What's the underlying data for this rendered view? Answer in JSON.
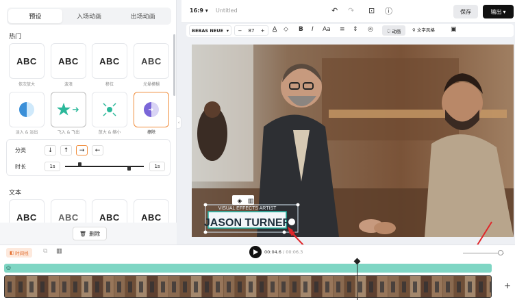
{
  "tabs": [
    "预设",
    "入场动画",
    "出场动画"
  ],
  "sections": {
    "hot": "热门",
    "text": "文本"
  },
  "cards_row1": [
    {
      "preview": "ABC",
      "label": "依次放大"
    },
    {
      "preview": "ABC",
      "label": "波浪"
    },
    {
      "preview": "ABC",
      "label": "移位"
    },
    {
      "preview": "ABC",
      "label": "光晕模糊"
    }
  ],
  "cards_row2": [
    {
      "label": "淡入 & 淡出"
    },
    {
      "label": "飞入 & 飞出"
    },
    {
      "label": "放大 & 缩小"
    },
    {
      "label": "擦除"
    }
  ],
  "cards_row3": [
    "ABC",
    "ABC",
    "ABC",
    "ABC"
  ],
  "props": {
    "category_label": "分类",
    "duration_label": "时长",
    "directions": [
      "↓",
      "↑",
      "→",
      "←"
    ],
    "time_start": "1s",
    "time_end": "1s"
  },
  "delete_label": "删除",
  "topbar": {
    "ratio": "16:9",
    "title": "Untitled",
    "save": "保存",
    "export": "输出"
  },
  "texttoolbar": {
    "font": "BEBAS NEUE",
    "size": "87",
    "animation": "动画",
    "text_style": "文字风格"
  },
  "overlay": {
    "subtitle": "VISUAL EFFECTS ARTIST",
    "name": "JASON TURNER"
  },
  "timeline": {
    "track_button": "时间线",
    "current": "00:04.6",
    "total": "00:06.3"
  },
  "colors": {
    "accent": "#f08c3a",
    "track": "#7fd6c4",
    "arrow": "#e0262a",
    "dark": "#111111"
  }
}
